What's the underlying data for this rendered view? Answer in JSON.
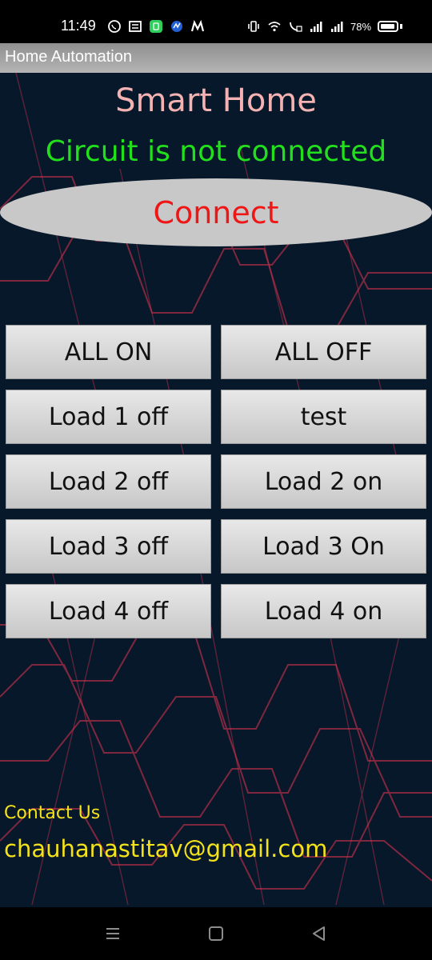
{
  "status_bar": {
    "time": "11:49",
    "battery": "78%"
  },
  "app": {
    "title": "Home Automation"
  },
  "main": {
    "heading": "Smart Home",
    "circuit_status": "Circuit is not connected",
    "connect_label": "Connect",
    "buttons": [
      {
        "label": "ALL ON"
      },
      {
        "label": "ALL OFF"
      },
      {
        "label": "Load 1 off"
      },
      {
        "label": "test"
      },
      {
        "label": "Load 2 off"
      },
      {
        "label": "Load 2 on"
      },
      {
        "label": "Load 3 off"
      },
      {
        "label": "Load 3 On"
      },
      {
        "label": "Load 4 off"
      },
      {
        "label": "Load 4 on"
      }
    ],
    "contact_label": "Contact Us",
    "contact_email": "chauhanastitav@gmail.com"
  },
  "colors": {
    "background": "#07182a",
    "heading": "#f4b2b2",
    "status": "#22e01c",
    "connect_text": "#ef1616",
    "contact": "#f4e21a",
    "bg_lines": "#e0344f"
  },
  "icons": {
    "status_left": [
      "whatsapp-icon",
      "news-icon",
      "app-icon",
      "cloud-icon",
      "m-icon"
    ],
    "status_right": [
      "vibrate-icon",
      "wifi-icon",
      "volte-icon",
      "signal-icon",
      "signal-icon",
      "battery-icon"
    ],
    "nav": [
      "menu-icon",
      "home-icon",
      "back-icon"
    ]
  }
}
